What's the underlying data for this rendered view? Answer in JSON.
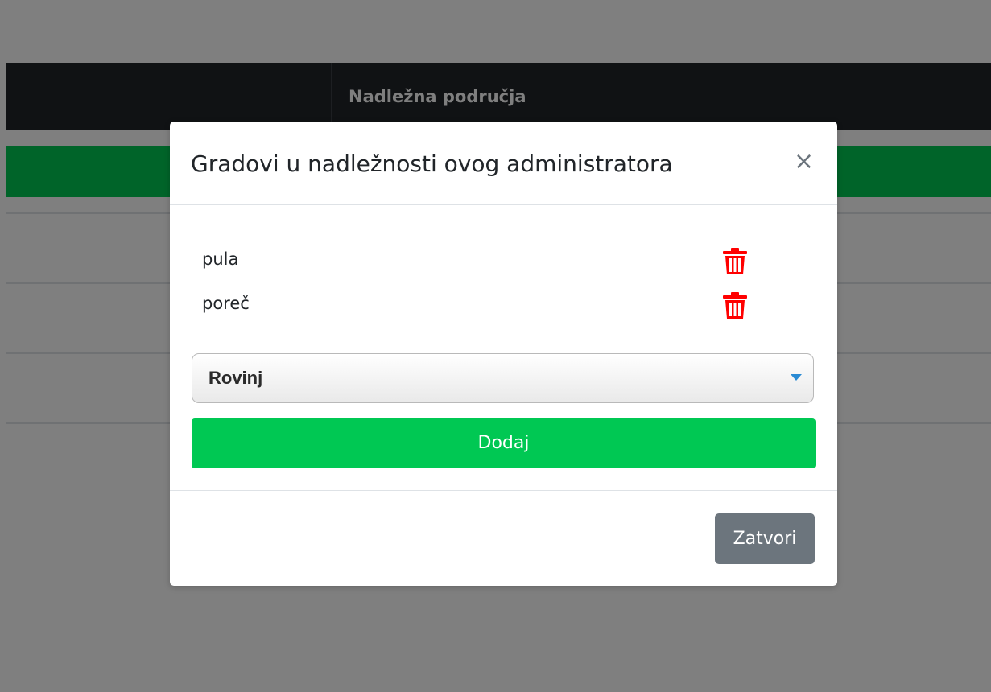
{
  "header": {
    "title": "Nadležna područja"
  },
  "modal": {
    "title": "Gradovi u nadležnosti ovog administratora",
    "close_symbol": "×",
    "cities": [
      {
        "name": "pula"
      },
      {
        "name": "poreč"
      }
    ],
    "select": {
      "selected": "Rovinj"
    },
    "add_label": "Dodaj",
    "footer_close_label": "Zatvori"
  },
  "colors": {
    "navbar": "#212529",
    "green": "#00c853",
    "delete_icon": "#ff0000",
    "secondary_button": "#6c757d",
    "select_arrow": "#2a8bd4"
  },
  "icons": {
    "delete": "trash-icon",
    "dropdown": "caret-down-icon",
    "close": "close-icon"
  }
}
